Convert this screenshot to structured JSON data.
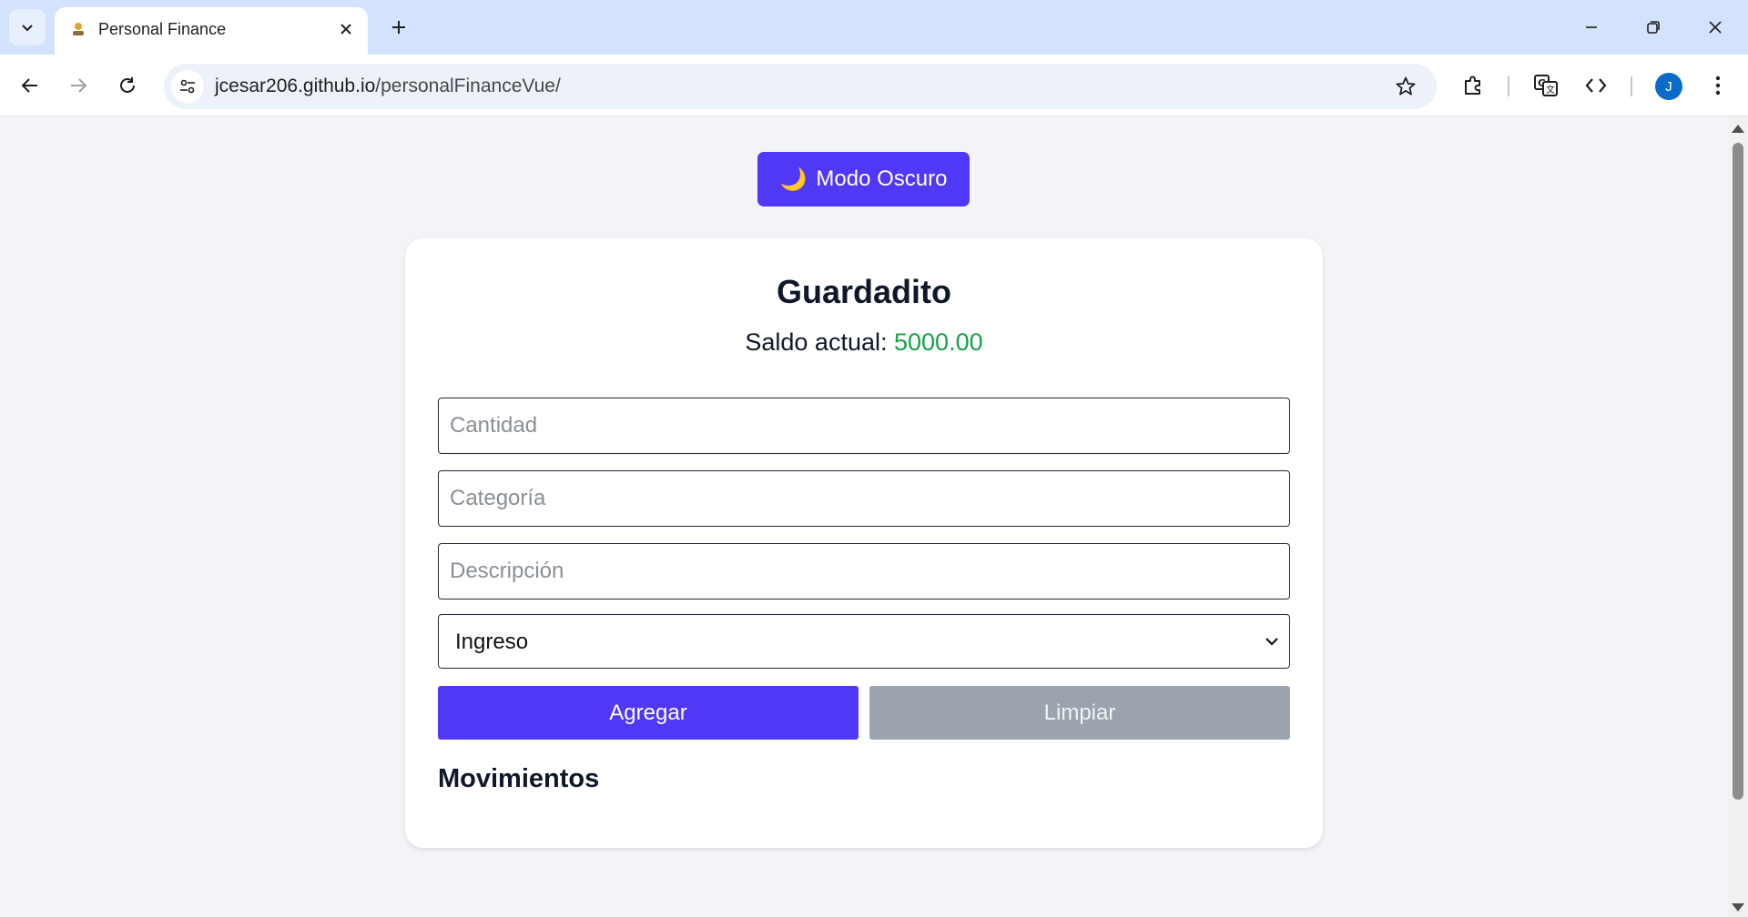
{
  "browser": {
    "tab_title": "Personal Finance",
    "url_host": "jcesar206.github.io",
    "url_path": "/personalFinanceVue/",
    "avatar_letter": "J",
    "icons": [
      "tab-search-icon",
      "favicon-icon",
      "close-icon",
      "plus-icon",
      "minimize-icon",
      "restore-icon",
      "window-close-icon",
      "back-icon",
      "forward-icon",
      "reload-icon",
      "site-info-icon",
      "star-icon",
      "extensions-icon",
      "translate-icon",
      "devtools-icon",
      "menu-dots-icon"
    ]
  },
  "page": {
    "dark_mode_emoji": "🌙",
    "dark_mode_label": "Modo Oscuro",
    "title": "Guardadito",
    "balance_label": "Saldo actual:",
    "balance_value": "5000.00",
    "amount_placeholder": "Cantidad",
    "category_placeholder": "Categoría",
    "description_placeholder": "Descripción",
    "type_selected": "Ingreso",
    "add_label": "Agregar",
    "clear_label": "Limpiar",
    "movements_title": "Movimientos"
  },
  "colors": {
    "accent": "#4f39f6",
    "balance_positive": "#16a34a",
    "clear_button": "#9aa3ae",
    "tab_strip": "#d3e3fd"
  }
}
